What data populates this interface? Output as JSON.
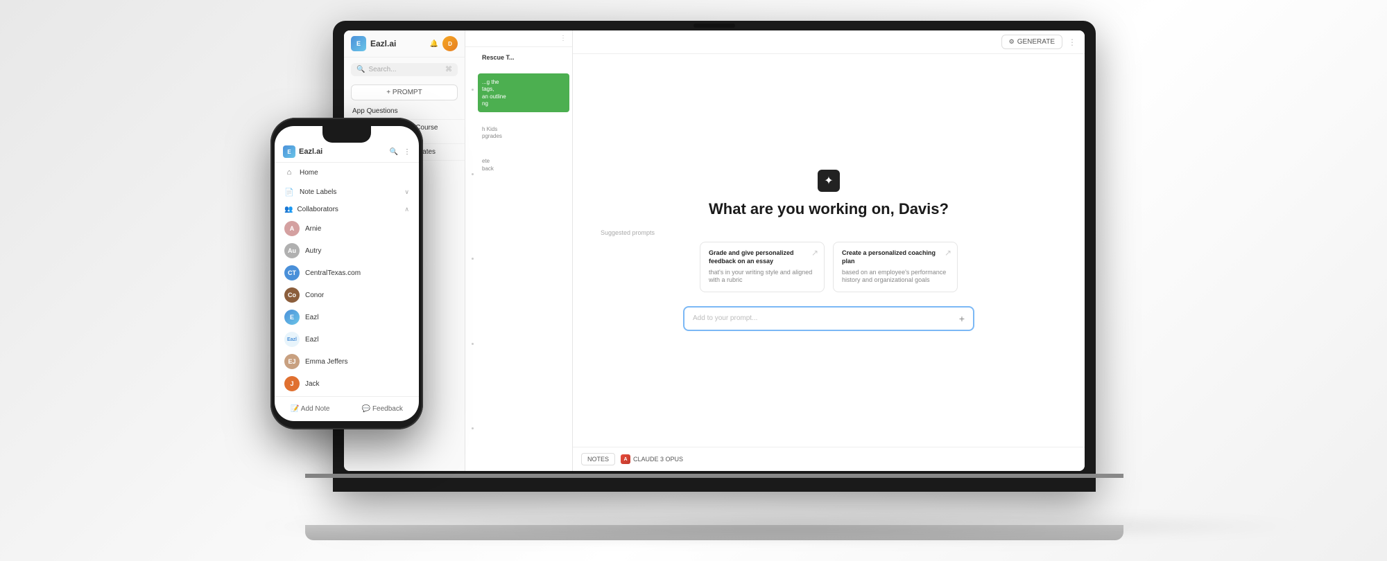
{
  "background": {
    "color": "#f0f0f0"
  },
  "laptop": {
    "sidebar": {
      "logo_text": "Eazl.ai",
      "search_placeholder": "Search...",
      "prompt_button": "+ PROMPT",
      "notes": [
        {
          "title": "App Questions",
          "id": 1
        },
        {
          "title": "Prompt Engineering Course Promo",
          "id": 2
        },
        {
          "title": "CentralTexas.com Updates",
          "id": 3
        }
      ]
    },
    "notes_panel": {
      "items": [
        {
          "title": "Rescue T...",
          "preview": "",
          "color": "normal"
        },
        {
          "title": "",
          "preview": "...g the\ntags,\nan outline\nng",
          "color": "green"
        },
        {
          "title": "h Kids\npgrades",
          "preview": "",
          "color": "normal"
        },
        {
          "title": "ete\nback",
          "preview": "",
          "color": "normal"
        }
      ]
    },
    "topbar": {
      "generate_button": "GENERATE",
      "bell_icon": "🔔",
      "more_icon": "⋮"
    },
    "main": {
      "robot_icon": "✦",
      "heading": "What are you working on, Davis?",
      "suggested_label": "Suggested prompts",
      "suggestions": [
        {
          "title": "Grade and give personalized feedback on an essay",
          "subtitle": "that's in your writing style and aligned with a rubric"
        },
        {
          "title": "Create a personalized coaching plan",
          "subtitle": "based on an employee's performance history and organizational goals"
        }
      ],
      "prompt_placeholder": "Add to your prompt...",
      "notes_btn": "NOTES",
      "model_label": "CLAUDE 3 OPUS"
    }
  },
  "phone": {
    "header": {
      "logo_text": "Eazl.ai",
      "search_icon": "🔍",
      "more_icon": "⋮"
    },
    "nav": [
      {
        "icon": "⌂",
        "label": "Home"
      },
      {
        "icon": "📄",
        "label": "Note Labels",
        "has_expand": true
      },
      {
        "icon": "👥",
        "label": "Collaborators",
        "is_section": true,
        "expanded": true
      }
    ],
    "collaborators": [
      {
        "name": "Arnie",
        "color": "#e8c4a0",
        "initials": "A"
      },
      {
        "name": "Autry",
        "color": "#b0b0b0",
        "initials": "Au"
      },
      {
        "name": "CentralTexas.com",
        "color": "#4a90d9",
        "initials": "C",
        "is_image": true
      },
      {
        "name": "Conor",
        "color": "#8b5e3c",
        "initials": "Co",
        "is_image": true
      },
      {
        "name": "Eazl",
        "color": "#4a90d9",
        "initials": "E",
        "is_logo": true
      },
      {
        "name": "Eazl",
        "color": "#4a90d9",
        "initials": "Eazl"
      },
      {
        "name": "Emma Jeffers",
        "color": "#d4a0a0",
        "initials": "EJ",
        "is_image": true
      },
      {
        "name": "Jack",
        "color": "#e07030",
        "initials": "J"
      }
    ],
    "bottom": [
      {
        "icon": "📝",
        "label": "Add Note"
      },
      {
        "icon": "💬",
        "label": "Feedback"
      }
    ]
  }
}
